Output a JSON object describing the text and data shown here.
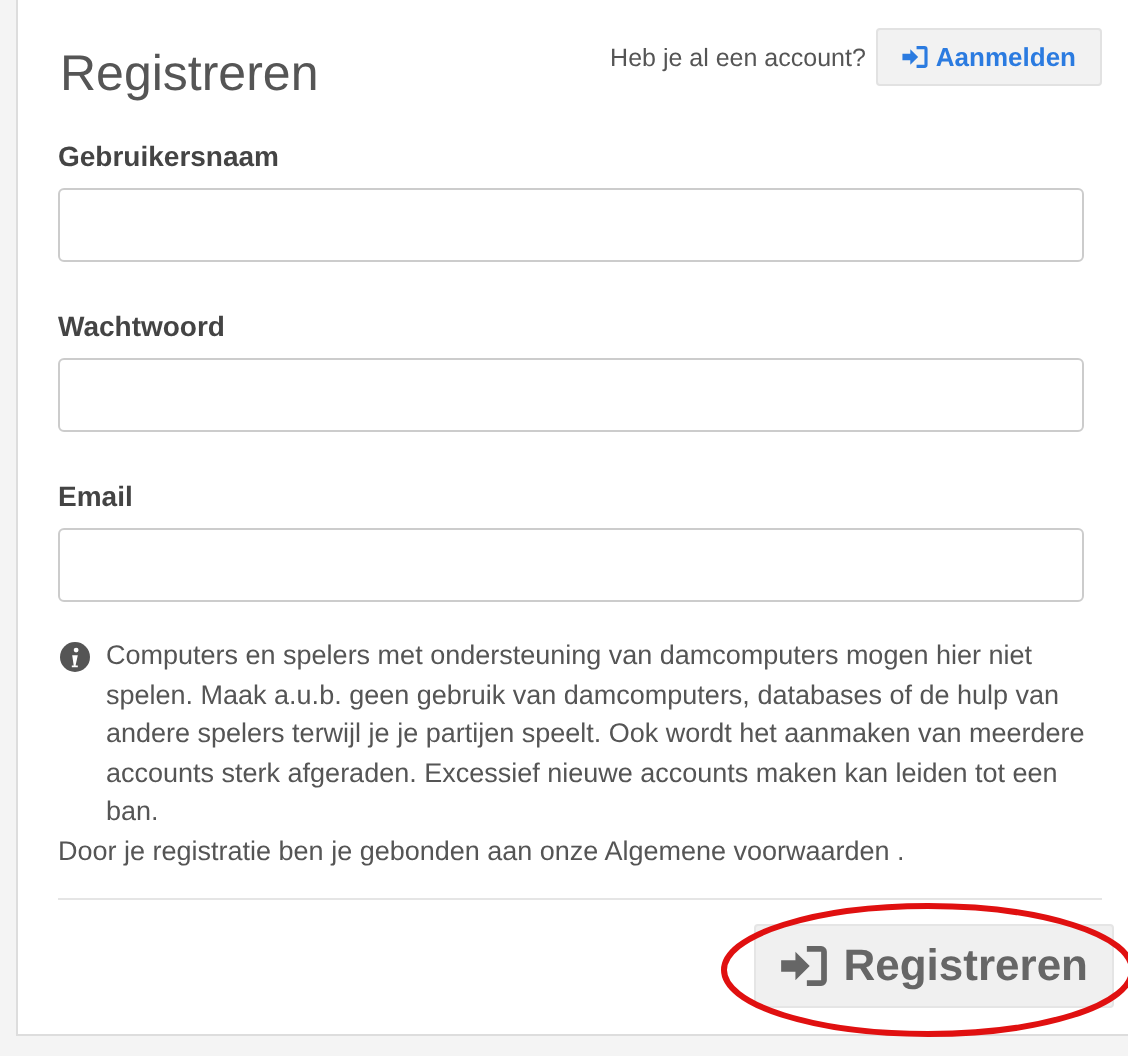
{
  "title": "Registreren",
  "account_prompt": "Heb je al een account?",
  "login_button": "Aanmelden",
  "fields": [
    {
      "label": "Gebruikersnaam"
    },
    {
      "label": "Wachtwoord"
    },
    {
      "label": "Email"
    }
  ],
  "notice": "Computers en spelers met ondersteuning van damcomputers mogen hier niet spelen. Maak a.u.b. geen gebruik van damcomputers, databases of de hulp van andere spelers terwijl je je partijen speelt. Ook wordt het aanmaken van meerdere accounts sterk afgeraden. Excessief nieuwe accounts maken kan leiden tot een ban.",
  "terms": "Door je registratie ben je gebonden aan onze Algemene voorwaarden .",
  "submit_button": "Registreren",
  "submit_highlighted": true
}
